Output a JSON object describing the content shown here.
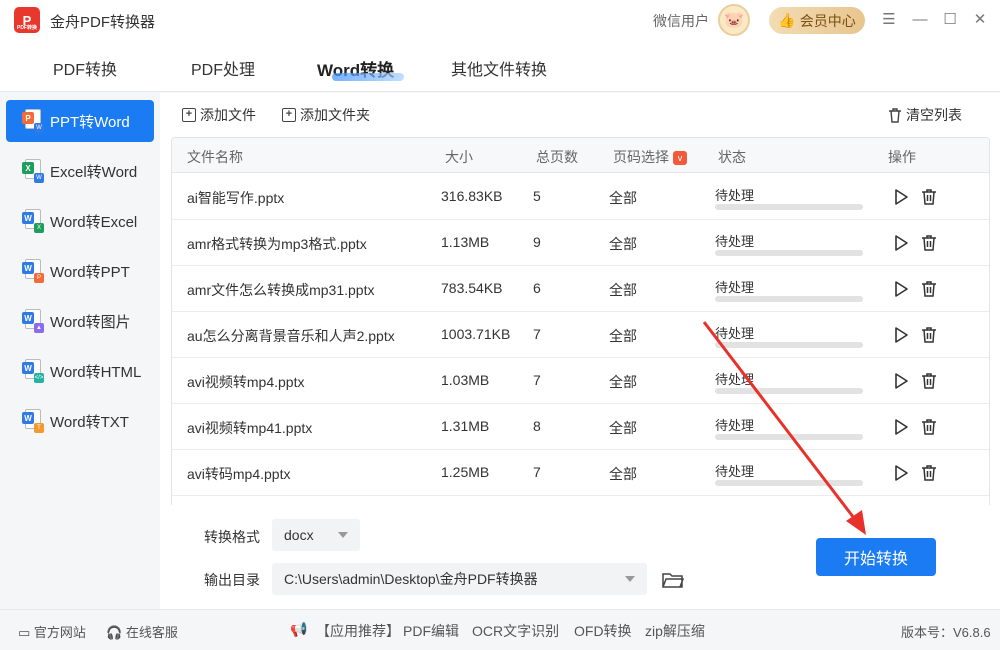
{
  "app": {
    "title": "金舟PDF转换器",
    "user_name": "微信用户",
    "vip_label": "会员中心",
    "version": "版本号：V6.8.6"
  },
  "tabs": [
    {
      "label": "PDF转换"
    },
    {
      "label": "PDF处理"
    },
    {
      "label": "Word转换",
      "active": true
    },
    {
      "label": "其他文件转换"
    }
  ],
  "sidebar": {
    "items": [
      {
        "label": "PPT转Word",
        "active": true,
        "icon": "ppt-to-word-icon"
      },
      {
        "label": "Excel转Word",
        "icon": "excel-to-word-icon"
      },
      {
        "label": "Word转Excel",
        "icon": "word-to-excel-icon"
      },
      {
        "label": "Word转PPT",
        "icon": "word-to-ppt-icon"
      },
      {
        "label": "Word转图片",
        "icon": "word-to-image-icon"
      },
      {
        "label": "Word转HTML",
        "icon": "word-to-html-icon"
      },
      {
        "label": "Word转TXT",
        "icon": "word-to-txt-icon"
      }
    ]
  },
  "toolbar": {
    "add_file": "添加文件",
    "add_folder": "添加文件夹",
    "clear_list": "清空列表"
  },
  "table": {
    "headers": {
      "name": "文件名称",
      "size": "大小",
      "pages": "总页数",
      "page_select": "页码选择",
      "status": "状态",
      "actions": "操作"
    },
    "rows": [
      {
        "name": "ai智能写作.pptx",
        "size": "316.83KB",
        "pages": "5",
        "page_select": "全部",
        "status": "待处理",
        "progress": 0
      },
      {
        "name": "amr格式转换为mp3格式.pptx",
        "size": "1.13MB",
        "pages": "9",
        "page_select": "全部",
        "status": "待处理",
        "progress": 0
      },
      {
        "name": "amr文件怎么转换成mp31.pptx",
        "size": "783.54KB",
        "pages": "6",
        "page_select": "全部",
        "status": "待处理",
        "progress": 0
      },
      {
        "name": "au怎么分离背景音乐和人声2.pptx",
        "size": "1003.71KB",
        "pages": "7",
        "page_select": "全部",
        "status": "待处理",
        "progress": 0
      },
      {
        "name": "avi视频转mp4.pptx",
        "size": "1.03MB",
        "pages": "7",
        "page_select": "全部",
        "status": "待处理",
        "progress": 0
      },
      {
        "name": "avi视频转mp41.pptx",
        "size": "1.31MB",
        "pages": "8",
        "page_select": "全部",
        "status": "待处理",
        "progress": 0
      },
      {
        "name": "avi转码mp4.pptx",
        "size": "1.25MB",
        "pages": "7",
        "page_select": "全部",
        "status": "待处理",
        "progress": 0
      }
    ]
  },
  "config": {
    "format_label": "转换格式",
    "format_value": "docx",
    "output_label": "输出目录",
    "output_value": "C:\\Users\\admin\\Desktop\\金舟PDF转换器",
    "start_label": "开始转换"
  },
  "footer": {
    "website": "官方网站",
    "support": "在线客服",
    "promo": "【应用推荐】",
    "links": [
      "PDF编辑",
      "OCR文字识别",
      "OFD转换",
      "zip解压缩"
    ]
  },
  "colors": {
    "accent": "#1a7bf2",
    "arrow": "#e8312a"
  }
}
